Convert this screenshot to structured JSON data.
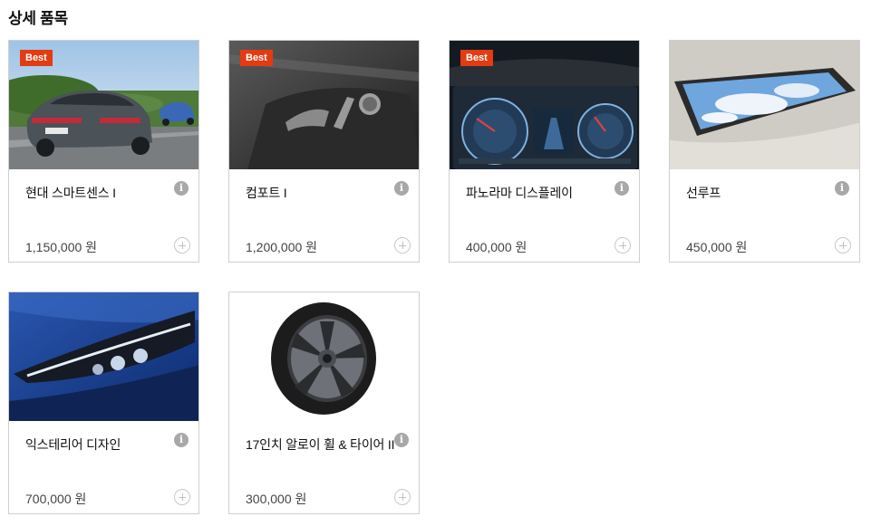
{
  "section": {
    "title": "상세 품목"
  },
  "items": [
    {
      "name": "현대 스마트센스 I",
      "price": "1,150,000 원",
      "badge": "Best",
      "image": "car-rear-view-photo"
    },
    {
      "name": "컴포트 I",
      "price": "1,200,000 원",
      "badge": "Best",
      "image": "seat-control-photo"
    },
    {
      "name": "파노라마 디스플레이",
      "price": "400,000 원",
      "badge": "Best",
      "image": "instrument-cluster-photo"
    },
    {
      "name": "선루프",
      "price": "450,000 원",
      "badge": "",
      "image": "sunroof-photo"
    },
    {
      "name": "익스테리어 디자인",
      "price": "700,000 원",
      "badge": "",
      "image": "headlamp-photo"
    },
    {
      "name": "17인치 알로이 휠 & 타이어 II",
      "price": "300,000 원",
      "badge": "",
      "image": "alloy-wheel-photo"
    }
  ],
  "icons": {
    "info": "info-icon",
    "add": "plus-circle-icon",
    "info_glyph": "i"
  },
  "colors": {
    "badge": "#e33b12",
    "border": "#cfcfcf",
    "info_icon": "#a8a8a8"
  }
}
